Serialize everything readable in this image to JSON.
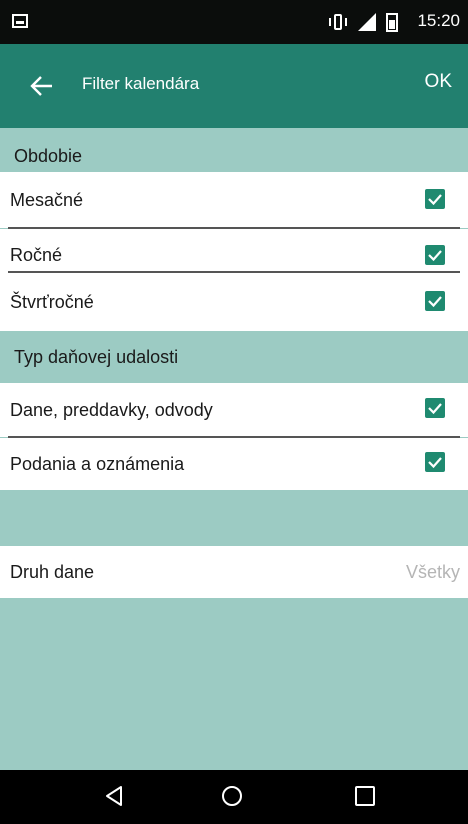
{
  "status_bar": {
    "time": "15:20",
    "icons": [
      "screenshot-icon",
      "vibrate-icon",
      "signal-icon",
      "battery-icon"
    ]
  },
  "app_bar": {
    "title": "Filter kalendára",
    "ok_label": "OK",
    "color": "#22806f"
  },
  "sections": {
    "period": {
      "header": "Obdobie",
      "items": [
        {
          "label": "Mesačné",
          "checked": true
        },
        {
          "label": "Ročné",
          "checked": true
        },
        {
          "label": "Štvrťročné",
          "checked": true
        }
      ]
    },
    "event_type": {
      "header": "Typ daňovej udalosti",
      "items": [
        {
          "label": "Dane, preddavky, odvody",
          "checked": true
        },
        {
          "label": "Podania a oznámenia",
          "checked": true
        }
      ]
    }
  },
  "tax_type": {
    "label": "Druh dane",
    "value": "Všetky"
  },
  "colors": {
    "accent": "#1f8a70",
    "section_bg": "#9ccbc3",
    "status_bar": "#0b0d0c"
  },
  "nav_bar": {
    "icons": [
      "back-triangle-icon",
      "home-circle-icon",
      "recents-square-icon"
    ]
  }
}
